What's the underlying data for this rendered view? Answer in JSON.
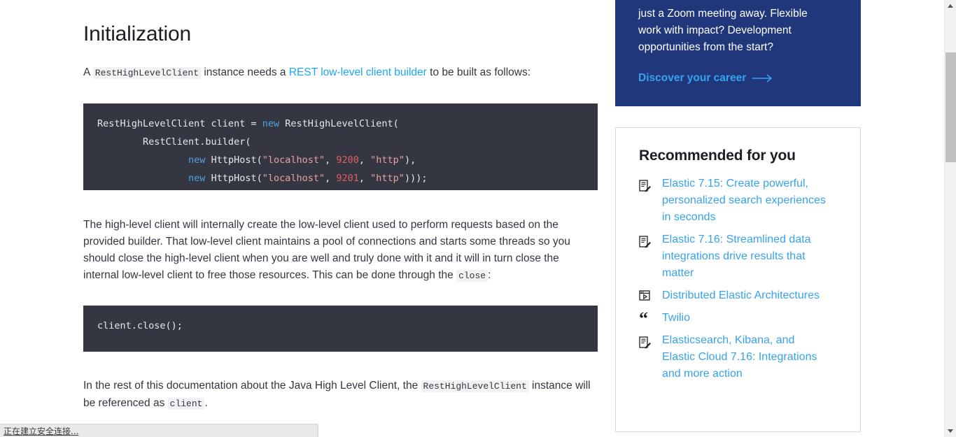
{
  "document": {
    "title": "Initialization",
    "intro": {
      "before_code": "A ",
      "code_token": "RestHighLevelClient",
      "middle": " instance needs a ",
      "link_text": "REST low-level client builder",
      "after_link": " to be built as follows:"
    },
    "code_block_1": {
      "language": "java",
      "lines": [
        [
          {
            "t": "RestHighLevelClient client = ",
            "c": "pln"
          },
          {
            "t": "new",
            "c": "kw"
          },
          {
            "t": " RestHighLevelClient(",
            "c": "pln"
          }
        ],
        [
          {
            "t": "        RestClient.builder(",
            "c": "pln"
          }
        ],
        [
          {
            "t": "                ",
            "c": "pln"
          },
          {
            "t": "new",
            "c": "kw"
          },
          {
            "t": " HttpHost(",
            "c": "pln"
          },
          {
            "t": "\"localhost\"",
            "c": "str"
          },
          {
            "t": ", ",
            "c": "pln"
          },
          {
            "t": "9200",
            "c": "num"
          },
          {
            "t": ", ",
            "c": "pln"
          },
          {
            "t": "\"http\"",
            "c": "str"
          },
          {
            "t": "),",
            "c": "pln"
          }
        ],
        [
          {
            "t": "                ",
            "c": "pln"
          },
          {
            "t": "new",
            "c": "kw"
          },
          {
            "t": " HttpHost(",
            "c": "pln"
          },
          {
            "t": "\"localhost\"",
            "c": "str"
          },
          {
            "t": ", ",
            "c": "pln"
          },
          {
            "t": "9201",
            "c": "num"
          },
          {
            "t": ", ",
            "c": "pln"
          },
          {
            "t": "\"http\"",
            "c": "str"
          },
          {
            "t": ")));",
            "c": "pln"
          }
        ]
      ]
    },
    "body_paragraph": {
      "text": "The high-level client will internally create the low-level client used to perform requests based on the provided builder. That low-level client maintains a pool of connections and starts some threads so you should close the high-level client when you are well and truly done with it and it will in turn close the internal low-level client to free those resources. This can be done through the ",
      "code_token": "close",
      "suffix": ":"
    },
    "code_block_2": {
      "language": "java",
      "lines": [
        [
          {
            "t": "client.close();",
            "c": "pln"
          }
        ]
      ]
    },
    "closing_paragraph": {
      "prefix": "In the rest of this documentation about the Java High Level Client, the ",
      "code_token_1": "RestHighLevelClient",
      "middle": " instance will be referenced as ",
      "code_token_2": "client",
      "suffix": "."
    }
  },
  "promo": {
    "body_line_1": "just a Zoom meeting away. Flexible",
    "body_line_2": "work with impact? Development",
    "body_line_3": "opportunities from the start?",
    "cta_label": "Discover your career",
    "background_color": "#21377c",
    "cta_color": "#36a2ef"
  },
  "recommended": {
    "heading": "Recommended for you",
    "items": [
      {
        "icon": "blog-post-icon",
        "title": "Elastic 7.15: Create powerful, personalized search experiences in seconds"
      },
      {
        "icon": "blog-post-icon",
        "title": "Elastic 7.16: Streamlined data integrations drive results that matter"
      },
      {
        "icon": "webinar-video-icon",
        "title": "Distributed Elastic Architectures"
      },
      {
        "icon": "quote-icon",
        "title": "Twilio"
      },
      {
        "icon": "blog-post-icon",
        "title": "Elasticsearch, Kibana, and Elastic Cloud 7.16: Integrations and more action"
      }
    ],
    "link_color": "#36a2ef"
  },
  "browser": {
    "status_text": "正在建立安全连接...",
    "scrollbar": {
      "up_arrow": "scroll-up-arrow",
      "down_arrow": "scroll-down-arrow"
    }
  }
}
